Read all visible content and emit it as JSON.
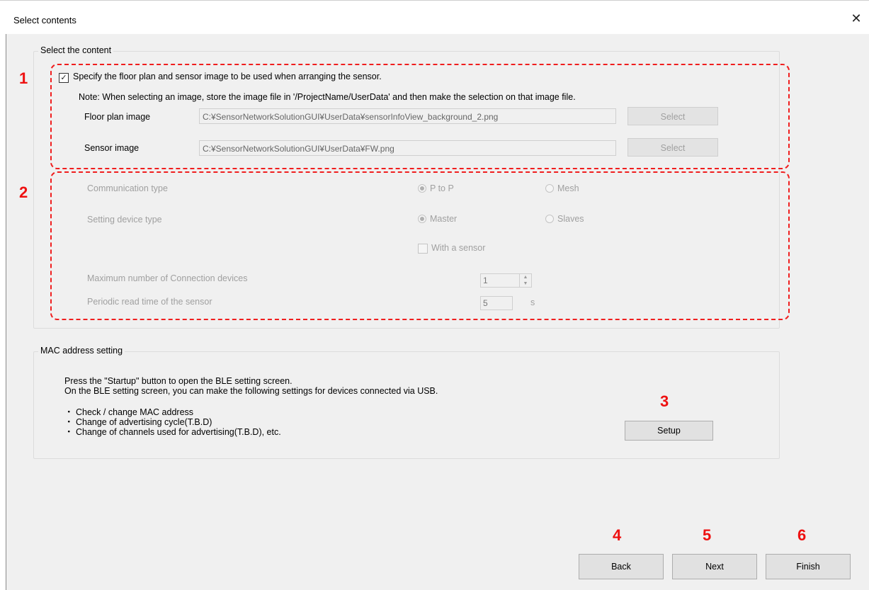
{
  "window": {
    "title": "Select contents",
    "close_glyph": "✕"
  },
  "content_group": {
    "legend": "Select the content",
    "specify_checkbox": {
      "label": "Specify the floor plan and sensor image to be used when arranging the sensor.",
      "checked": true
    },
    "note": "Note: When selecting an image, store the image file in '/ProjectName/UserData' and then make the selection on that image file.",
    "floor_plan": {
      "label": "Floor plan image",
      "value": "C:¥SensorNetworkSolutionGUI¥UserData¥sensorInfoView_background_2.png",
      "button": "Select"
    },
    "sensor_image": {
      "label": "Sensor image",
      "value": "C:¥SensorNetworkSolutionGUI¥UserData¥FW.png",
      "button": "Select"
    },
    "communication_type": {
      "label": "Communication type",
      "options": [
        "P to P",
        "Mesh"
      ],
      "selected": "P to P"
    },
    "setting_device_type": {
      "label": "Setting device type",
      "options": [
        "Master",
        "Slaves"
      ],
      "selected": "Master"
    },
    "with_sensor": {
      "label": "With a sensor",
      "checked": false
    },
    "max_connection": {
      "label": "Maximum number of Connection devices",
      "value": "1"
    },
    "periodic_read": {
      "label": "Periodic read time of the sensor",
      "value": "5",
      "unit": "s"
    }
  },
  "mac_group": {
    "legend": "MAC address setting",
    "line1": "Press the \"Startup\" button to open the BLE setting screen.",
    "line2": "On the BLE setting screen, you can make the following settings for devices connected via USB.",
    "bullets": [
      "・ Check / change MAC address",
      "・ Change of advertising cycle(T.B.D)",
      "・ Change of channels used for advertising(T.B.D), etc."
    ],
    "setup_button": "Setup"
  },
  "footer": {
    "back": "Back",
    "next": "Next",
    "finish": "Finish"
  },
  "annotations": {
    "m1": "1",
    "m2": "2",
    "m3": "3",
    "m4": "4",
    "m5": "5",
    "m6": "6"
  },
  "colors": {
    "annotation_red": "#ee1111",
    "dialog_bg": "#f0f0f0"
  }
}
